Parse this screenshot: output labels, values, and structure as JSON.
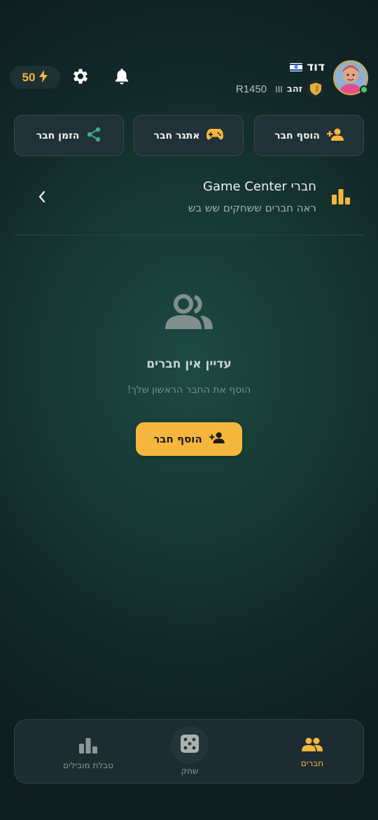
{
  "header": {
    "energy": "50",
    "username": "דוד",
    "rank_name": "זהב",
    "rank_tier": "III",
    "rating": "R1450",
    "icons": [
      "lightning-icon",
      "gear-icon",
      "bell-icon",
      "israel-flag-icon",
      "shield-badge-icon"
    ]
  },
  "actions": {
    "add_friend": "הוסף חבר",
    "challenge_friend": "אתגר חבר",
    "invite_friend": "הזמן חבר"
  },
  "game_center": {
    "title": "חברי Game Center",
    "subtitle": "ראה חברים ששחקים שש בש"
  },
  "empty_state": {
    "title": "עדיין אין חברים",
    "subtitle": "הוסף את החבר הראשון שלך!",
    "button": "הוסף חבר"
  },
  "nav": {
    "leaderboard": "טבלת מובילים",
    "play": "שחק",
    "friends": "חברים"
  },
  "colors": {
    "accent": "#f4b63d",
    "teal": "#3fa89b",
    "online": "#4cc860"
  }
}
